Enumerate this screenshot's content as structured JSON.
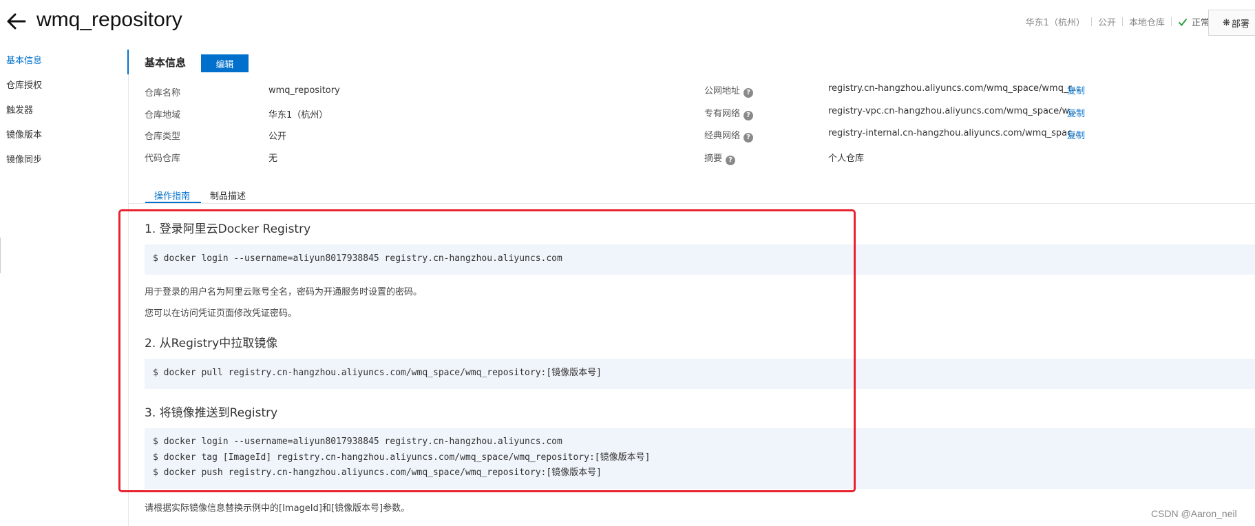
{
  "header": {
    "title": "wmq_repository",
    "region": "华东1（杭州）",
    "visibility": "公开",
    "repo_kind": "本地仓库",
    "status": "正常",
    "deploy_label": "部署"
  },
  "sidebar": {
    "items": [
      {
        "label": "基本信息"
      },
      {
        "label": "仓库授权"
      },
      {
        "label": "触发器"
      },
      {
        "label": "镜像版本"
      },
      {
        "label": "镜像同步"
      }
    ]
  },
  "basic_info": {
    "title": "基本信息",
    "edit_label": "编辑",
    "left": [
      {
        "label": "仓库名称",
        "value": "wmq_repository"
      },
      {
        "label": "仓库地域",
        "value": "华东1（杭州）"
      },
      {
        "label": "仓库类型",
        "value": "公开"
      },
      {
        "label": "代码仓库",
        "value": "无"
      }
    ],
    "right": [
      {
        "label": "公网地址",
        "value": "registry.cn-hangzhou.aliyuncs.com/wmq_space/wmq_r...",
        "copy": "复制"
      },
      {
        "label": "专有网络",
        "value": "registry-vpc.cn-hangzhou.aliyuncs.com/wmq_space/w...",
        "copy": "复制"
      },
      {
        "label": "经典网络",
        "value": "registry-internal.cn-hangzhou.aliyuncs.com/wmq_spac...",
        "copy": "复制"
      },
      {
        "label": "摘要",
        "value": "个人仓库"
      }
    ]
  },
  "tabs": [
    {
      "label": "操作指南"
    },
    {
      "label": "制品描述"
    }
  ],
  "guide": {
    "step1": {
      "heading": "1. 登录阿里云Docker Registry",
      "code": [
        "$ docker login --username=aliyun8017938845 registry.cn-hangzhou.aliyuncs.com"
      ],
      "notes": [
        "用于登录的用户名为阿里云账号全名，密码为开通服务时设置的密码。",
        "您可以在访问凭证页面修改凭证密码。"
      ]
    },
    "step2": {
      "heading": "2. 从Registry中拉取镜像",
      "code": [
        "$ docker pull registry.cn-hangzhou.aliyuncs.com/wmq_space/wmq_repository:[镜像版本号]"
      ]
    },
    "step3": {
      "heading": "3. 将镜像推送到Registry",
      "code": [
        "$ docker login --username=aliyun8017938845 registry.cn-hangzhou.aliyuncs.com",
        "$ docker tag [ImageId] registry.cn-hangzhou.aliyuncs.com/wmq_space/wmq_repository:[镜像版本号]",
        "$ docker push registry.cn-hangzhou.aliyuncs.com/wmq_space/wmq_repository:[镜像版本号]"
      ]
    },
    "footer_note": "请根据实际镜像信息替换示例中的[ImageId]和[镜像版本号]参数。"
  },
  "watermark": "CSDN @Aaron_neil",
  "colors": {
    "accent": "#0070cc",
    "highlight": "#e8232f",
    "code_bg": "#f0f5fb",
    "ok": "#2e9e44"
  }
}
